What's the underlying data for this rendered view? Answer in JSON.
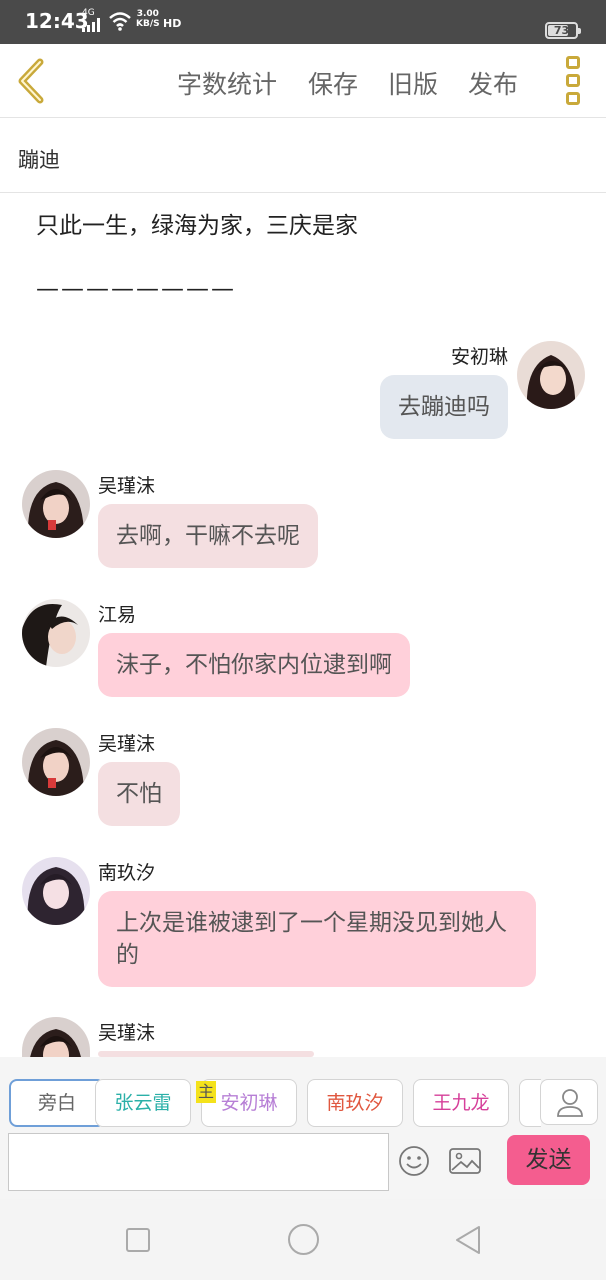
{
  "status_bar": {
    "time": "12:43",
    "network": "4G",
    "speed_value": "3.00",
    "speed_unit": "KB/S",
    "hd": "HD",
    "battery": "73",
    "battery_level_pct": 73
  },
  "toolbar": {
    "word_count": "字数统计",
    "save": "保存",
    "old_version": "旧版",
    "publish": "发布"
  },
  "title": "蹦迪",
  "intro": {
    "text": "只此一生，绿海为家，三庆是家",
    "divider": "————————"
  },
  "messages": [
    {
      "name": "安初琳",
      "text": "去蹦迪吗",
      "side": "right"
    },
    {
      "name": "吴瑾沫",
      "text": "去啊，干嘛不去呢",
      "side": "left"
    },
    {
      "name": "江易",
      "text": "沫子，不怕你家内位逮到啊",
      "side": "left"
    },
    {
      "name": "吴瑾沫",
      "text": "不怕",
      "side": "left"
    },
    {
      "name": "南玖汐",
      "text": "上次是谁被逮到了一个星期没见到她人的",
      "side": "left"
    },
    {
      "name": "吴瑾沫",
      "text": "",
      "side": "left"
    }
  ],
  "roles": [
    {
      "label": "旁白",
      "color": "#666666"
    },
    {
      "label": "张云雷",
      "color": "#2bb0a8"
    },
    {
      "label": "安初琳",
      "color": "#b77fd6"
    },
    {
      "label": "南玖汐",
      "color": "#e0573f"
    },
    {
      "label": "王九龙",
      "color": "#d6409a"
    }
  ],
  "main_badge": "主",
  "composer": {
    "send": "发送",
    "input_value": ""
  },
  "colors": {
    "accent": "#f45d8f",
    "back_arrow": "#c9a93a"
  },
  "icons": [
    "back-arrow-icon",
    "more-icon",
    "user-icon",
    "emoji-icon",
    "image-icon",
    "nav-recents-icon",
    "nav-home-icon",
    "nav-back-icon"
  ]
}
